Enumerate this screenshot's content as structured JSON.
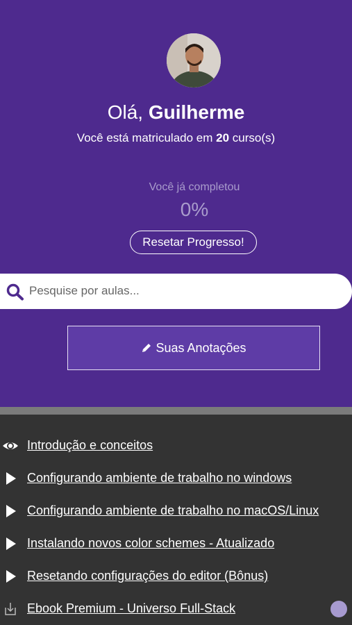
{
  "profile": {
    "greeting_prefix": "Olá,",
    "user_name": "Guilherme",
    "enrolled_prefix": "Você está matriculado em",
    "enrolled_count": "20",
    "enrolled_suffix": "curso(s)"
  },
  "progress": {
    "label": "Você já completou",
    "value": "0%",
    "reset_label": "Resetar Progresso!"
  },
  "search": {
    "placeholder": "Pesquise por aulas...",
    "value": ""
  },
  "notes": {
    "label": "Suas Anotações",
    "icon": "pencil-icon"
  },
  "lessons": [
    {
      "title": "Introdução e conceitos",
      "icon": "eye-icon"
    },
    {
      "title": "Configurando ambiente de trabalho no windows",
      "icon": "play-icon"
    },
    {
      "title": "Configurando ambiente de trabalho no macOS/Linux",
      "icon": "play-icon"
    },
    {
      "title": "Instalando novos color schemes - Atualizado",
      "icon": "play-icon"
    },
    {
      "title": "Resetando configurações do editor (Bônus)",
      "icon": "play-icon"
    },
    {
      "title": "Ebook Premium - Universo Full-Stack",
      "icon": "download-icon"
    }
  ],
  "colors": {
    "header_bg": "#4e2a8e",
    "notes_button_bg": "#5e3ca6",
    "lessons_bg": "#333333",
    "accent_dot": "#a79ad0"
  }
}
